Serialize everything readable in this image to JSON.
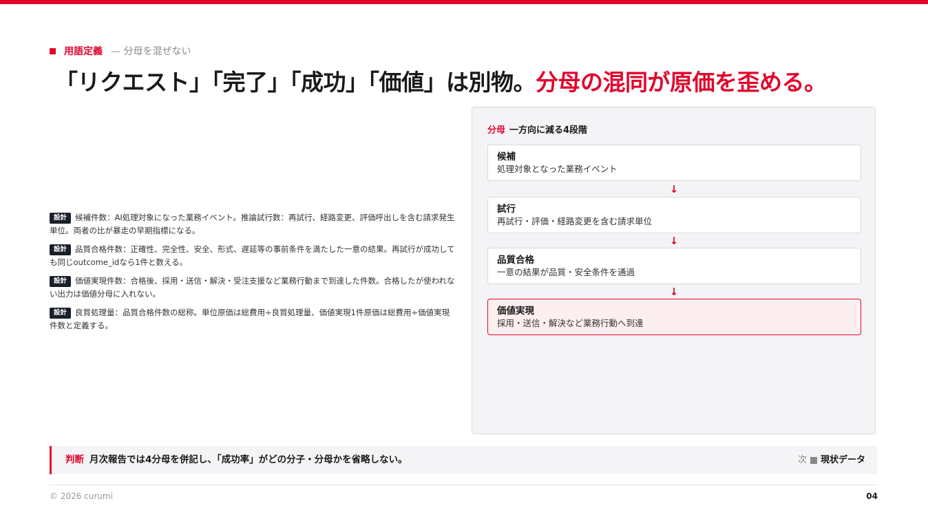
{
  "eyebrow": {
    "label": "用語定義",
    "sub": "— 分母を混ぜない"
  },
  "title": {
    "main": "「リクエスト」「完了」「成功」「価値」は別物。",
    "accent": "分母の混同が原価を歪める。"
  },
  "notes": [
    {
      "badge": "設計",
      "text": "候補件数：AI処理対象になった業務イベント。推論試行数：再試行、経路変更、評価呼出しを含む請求発生単位。両者の比が暴走の早期指標になる。"
    },
    {
      "badge": "設計",
      "text": "品質合格件数：正確性、完全性、安全、形式、遅延等の事前条件を満たした一意の結果。再試行が成功しても同じoutcome_idなら1件と数える。"
    },
    {
      "badge": "設計",
      "text": "価値実現件数：合格後、採用・送信・解決・受注支援など業務行動まで到達した件数。合格したが使われない出力は価値分母に入れない。"
    },
    {
      "badge": "設計",
      "text": "良質処理量：品質合格件数の総称。単位原価は総費用÷良質処理量、価値実現1件原価は総費用÷価値実現件数と定義する。"
    }
  ],
  "panel": {
    "head_red": "分母",
    "head": "一方向に減る4段階",
    "arrow": "↓",
    "stages": [
      {
        "title": "候補",
        "desc": "処理対象となった業務イベント"
      },
      {
        "title": "試行",
        "desc": "再試行・評価・経路変更を含む請求単位"
      },
      {
        "title": "品質合格",
        "desc": "一意の結果が品質・安全条件を通過"
      },
      {
        "title": "価値実現",
        "desc": "採用・送信・解決など業務行動へ到達"
      }
    ]
  },
  "judge": {
    "label": "判断",
    "text": "月次報告では4分母を併記し、「成功率」がどの分子・分母かを省略しない。"
  },
  "next": {
    "prefix": "次",
    "title": "現状データ"
  },
  "footer": {
    "copyright": "© 2026 curumi",
    "page": "04"
  },
  "colors": {
    "accent": "#e1062c",
    "badge": "#1a1f2b",
    "panel_bg": "#f4f4f6"
  }
}
